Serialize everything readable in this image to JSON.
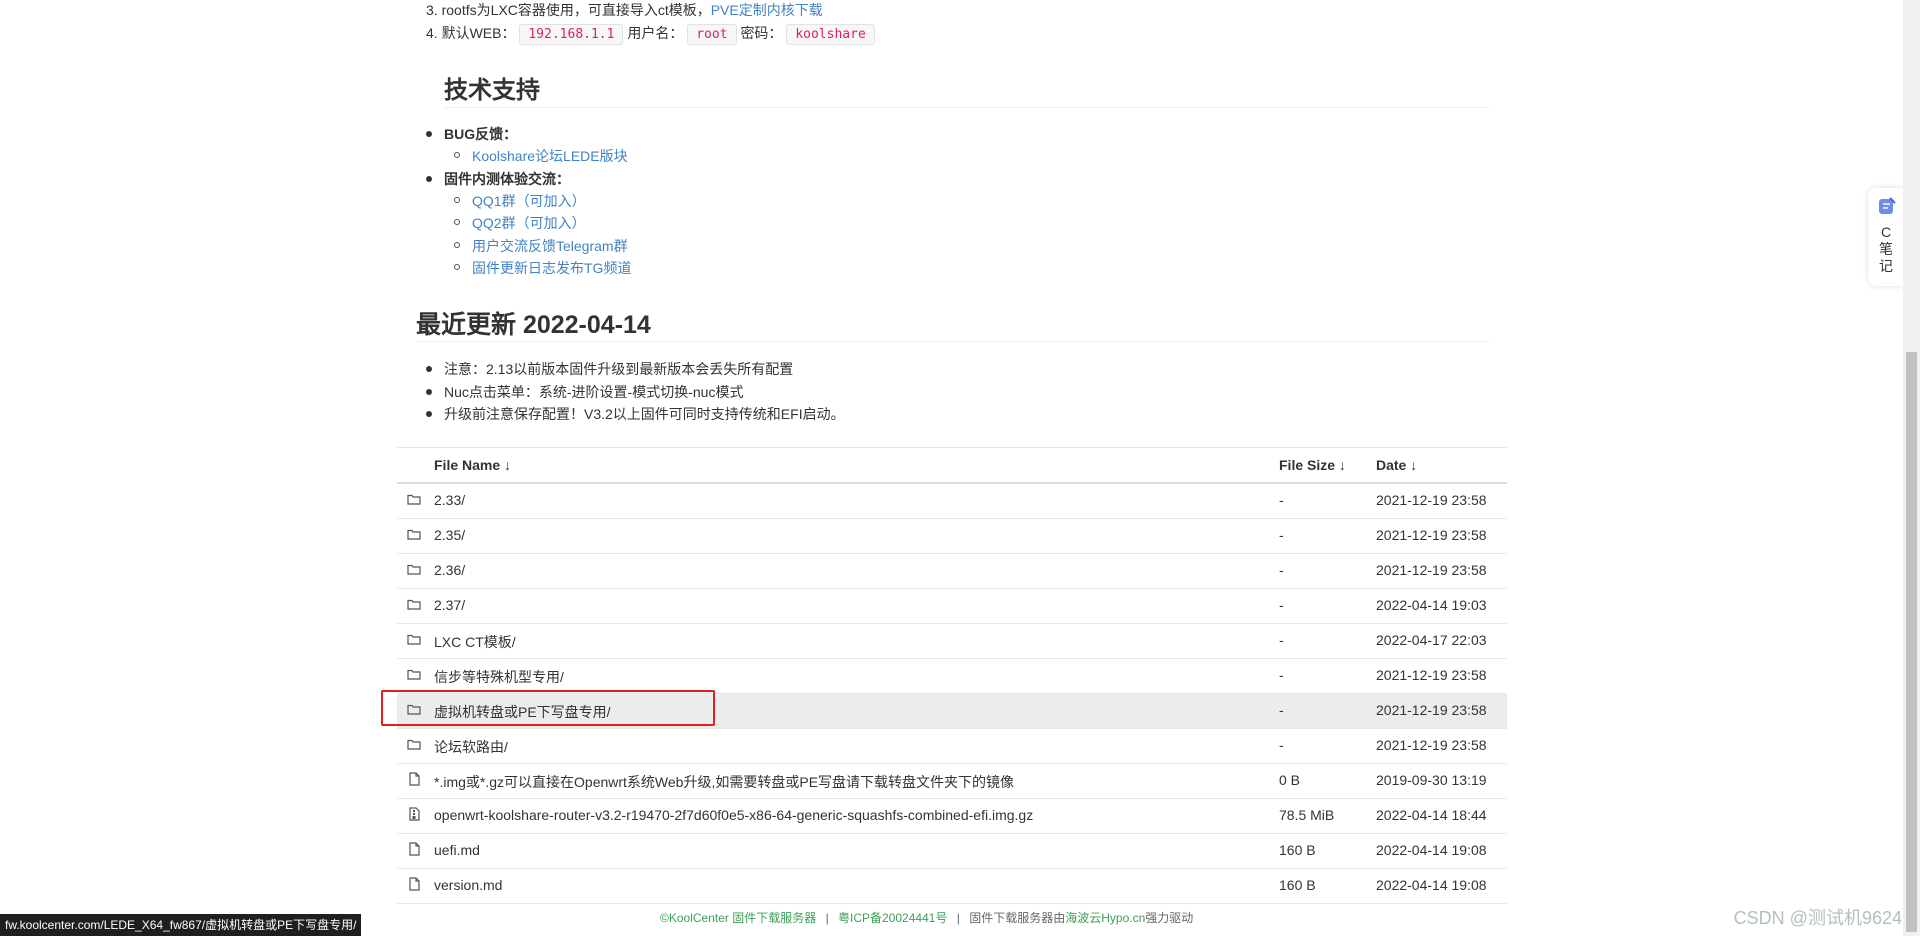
{
  "intro": {
    "item3_number": "3.",
    "item3_text": "rootfs为LXC容器使用，可直接导入ct模板，",
    "item3_link": "PVE定制内核下载",
    "item4_number": "4.",
    "item4_web_label": "默认WEB：",
    "item4_ip": "192.168.1.1",
    "item4_user_label": "用户名：",
    "item4_user": "root",
    "item4_pass_label": "密码：",
    "item4_pass": "koolshare"
  },
  "support": {
    "heading": "技术支持",
    "bug_label": "BUG反馈：",
    "bug_link": "Koolshare论坛LEDE版块",
    "beta_label": "固件内测体验交流：",
    "links": [
      "QQ1群（可加入）",
      "QQ2群（可加入）",
      "用户交流反馈Telegram群",
      "固件更新日志发布TG频道"
    ]
  },
  "update": {
    "heading": "最近更新 2022-04-14",
    "notes": [
      "注意：2.13以前版本固件升级到最新版本会丢失所有配置",
      "Nuc点击菜单：系统-进阶设置-模式切换-nuc模式",
      "升级前注意保存配置！V3.2以上固件可同时支持传统和EFI启动。"
    ]
  },
  "table": {
    "headers": {
      "name": "File Name  ↓",
      "size": "File Size  ↓",
      "date": "Date  ↓"
    },
    "rows": [
      {
        "type": "folder",
        "name": "2.33/",
        "size": "-",
        "date": "2021-12-19 23:58"
      },
      {
        "type": "folder",
        "name": "2.35/",
        "size": "-",
        "date": "2021-12-19 23:58"
      },
      {
        "type": "folder",
        "name": "2.36/",
        "size": "-",
        "date": "2021-12-19 23:58"
      },
      {
        "type": "folder",
        "name": "2.37/",
        "size": "-",
        "date": "2022-04-14 19:03"
      },
      {
        "type": "folder",
        "name": "LXC CT模板/",
        "size": "-",
        "date": "2022-04-17 22:03"
      },
      {
        "type": "folder",
        "name": "信步等特殊机型专用/",
        "size": "-",
        "date": "2021-12-19 23:58"
      },
      {
        "type": "folder",
        "name": "虚拟机转盘或PE下写盘专用/",
        "size": "-",
        "date": "2021-12-19 23:58"
      },
      {
        "type": "folder",
        "name": "论坛软路由/",
        "size": "-",
        "date": "2021-12-19 23:58"
      },
      {
        "type": "file",
        "name": "*.img或*.gz可以直接在Openwrt系统Web升级,如需要转盘或PE写盘请下载转盘文件夹下的镜像",
        "size": "0 B",
        "date": "2019-09-30 13:19"
      },
      {
        "type": "archive",
        "name": "openwrt-koolshare-router-v3.2-r19470-2f7d60f0e5-x86-64-generic-squashfs-combined-efi.img.gz",
        "size": "78.5 MiB",
        "date": "2022-04-14 18:44"
      },
      {
        "type": "file",
        "name": "uefi.md",
        "size": "160 B",
        "date": "2022-04-14 19:08"
      },
      {
        "type": "file",
        "name": "version.md",
        "size": "160 B",
        "date": "2022-04-14 19:08"
      }
    ]
  },
  "footer": {
    "copyright": "©KoolCenter 固件下载服务器",
    "sep1": "|",
    "icp": "粤ICP备20024441号",
    "sep2": "|",
    "host_prefix": "固件下载服务器由",
    "host_link": "海波云Hypo.cn",
    "host_suffix": "强力驱动"
  },
  "status_url": "fw.koolcenter.com/LEDE_X64_fw867/虚拟机转盘或PE下写盘专用/",
  "side_widget": {
    "c": "C",
    "label1": "笔",
    "label2": "记"
  },
  "watermark": "CSDN @测试机9624",
  "colors": {
    "link": "#4183c4",
    "code": "#e01e5a",
    "highlight": "#e02020",
    "footer_green": "#3c9f56"
  }
}
